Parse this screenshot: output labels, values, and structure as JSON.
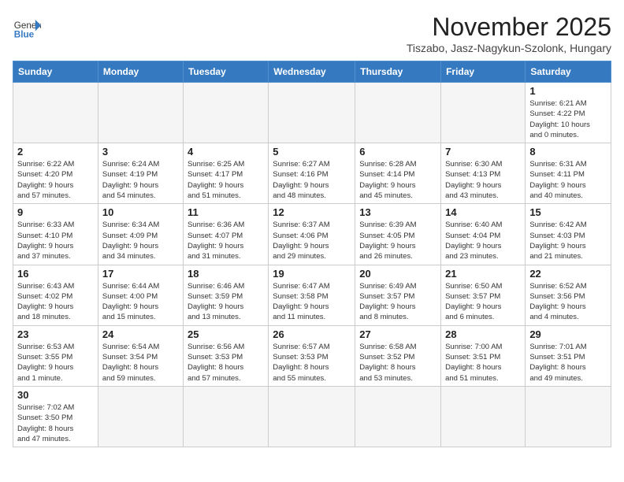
{
  "header": {
    "logo_general": "General",
    "logo_blue": "Blue",
    "month_title": "November 2025",
    "location": "Tiszabo, Jasz-Nagykun-Szolonk, Hungary"
  },
  "weekdays": [
    "Sunday",
    "Monday",
    "Tuesday",
    "Wednesday",
    "Thursday",
    "Friday",
    "Saturday"
  ],
  "weeks": [
    [
      {
        "day": "",
        "info": ""
      },
      {
        "day": "",
        "info": ""
      },
      {
        "day": "",
        "info": ""
      },
      {
        "day": "",
        "info": ""
      },
      {
        "day": "",
        "info": ""
      },
      {
        "day": "",
        "info": ""
      },
      {
        "day": "1",
        "info": "Sunrise: 6:21 AM\nSunset: 4:22 PM\nDaylight: 10 hours\nand 0 minutes."
      }
    ],
    [
      {
        "day": "2",
        "info": "Sunrise: 6:22 AM\nSunset: 4:20 PM\nDaylight: 9 hours\nand 57 minutes."
      },
      {
        "day": "3",
        "info": "Sunrise: 6:24 AM\nSunset: 4:19 PM\nDaylight: 9 hours\nand 54 minutes."
      },
      {
        "day": "4",
        "info": "Sunrise: 6:25 AM\nSunset: 4:17 PM\nDaylight: 9 hours\nand 51 minutes."
      },
      {
        "day": "5",
        "info": "Sunrise: 6:27 AM\nSunset: 4:16 PM\nDaylight: 9 hours\nand 48 minutes."
      },
      {
        "day": "6",
        "info": "Sunrise: 6:28 AM\nSunset: 4:14 PM\nDaylight: 9 hours\nand 45 minutes."
      },
      {
        "day": "7",
        "info": "Sunrise: 6:30 AM\nSunset: 4:13 PM\nDaylight: 9 hours\nand 43 minutes."
      },
      {
        "day": "8",
        "info": "Sunrise: 6:31 AM\nSunset: 4:11 PM\nDaylight: 9 hours\nand 40 minutes."
      }
    ],
    [
      {
        "day": "9",
        "info": "Sunrise: 6:33 AM\nSunset: 4:10 PM\nDaylight: 9 hours\nand 37 minutes."
      },
      {
        "day": "10",
        "info": "Sunrise: 6:34 AM\nSunset: 4:09 PM\nDaylight: 9 hours\nand 34 minutes."
      },
      {
        "day": "11",
        "info": "Sunrise: 6:36 AM\nSunset: 4:07 PM\nDaylight: 9 hours\nand 31 minutes."
      },
      {
        "day": "12",
        "info": "Sunrise: 6:37 AM\nSunset: 4:06 PM\nDaylight: 9 hours\nand 29 minutes."
      },
      {
        "day": "13",
        "info": "Sunrise: 6:39 AM\nSunset: 4:05 PM\nDaylight: 9 hours\nand 26 minutes."
      },
      {
        "day": "14",
        "info": "Sunrise: 6:40 AM\nSunset: 4:04 PM\nDaylight: 9 hours\nand 23 minutes."
      },
      {
        "day": "15",
        "info": "Sunrise: 6:42 AM\nSunset: 4:03 PM\nDaylight: 9 hours\nand 21 minutes."
      }
    ],
    [
      {
        "day": "16",
        "info": "Sunrise: 6:43 AM\nSunset: 4:02 PM\nDaylight: 9 hours\nand 18 minutes."
      },
      {
        "day": "17",
        "info": "Sunrise: 6:44 AM\nSunset: 4:00 PM\nDaylight: 9 hours\nand 15 minutes."
      },
      {
        "day": "18",
        "info": "Sunrise: 6:46 AM\nSunset: 3:59 PM\nDaylight: 9 hours\nand 13 minutes."
      },
      {
        "day": "19",
        "info": "Sunrise: 6:47 AM\nSunset: 3:58 PM\nDaylight: 9 hours\nand 11 minutes."
      },
      {
        "day": "20",
        "info": "Sunrise: 6:49 AM\nSunset: 3:57 PM\nDaylight: 9 hours\nand 8 minutes."
      },
      {
        "day": "21",
        "info": "Sunrise: 6:50 AM\nSunset: 3:57 PM\nDaylight: 9 hours\nand 6 minutes."
      },
      {
        "day": "22",
        "info": "Sunrise: 6:52 AM\nSunset: 3:56 PM\nDaylight: 9 hours\nand 4 minutes."
      }
    ],
    [
      {
        "day": "23",
        "info": "Sunrise: 6:53 AM\nSunset: 3:55 PM\nDaylight: 9 hours\nand 1 minute."
      },
      {
        "day": "24",
        "info": "Sunrise: 6:54 AM\nSunset: 3:54 PM\nDaylight: 8 hours\nand 59 minutes."
      },
      {
        "day": "25",
        "info": "Sunrise: 6:56 AM\nSunset: 3:53 PM\nDaylight: 8 hours\nand 57 minutes."
      },
      {
        "day": "26",
        "info": "Sunrise: 6:57 AM\nSunset: 3:53 PM\nDaylight: 8 hours\nand 55 minutes."
      },
      {
        "day": "27",
        "info": "Sunrise: 6:58 AM\nSunset: 3:52 PM\nDaylight: 8 hours\nand 53 minutes."
      },
      {
        "day": "28",
        "info": "Sunrise: 7:00 AM\nSunset: 3:51 PM\nDaylight: 8 hours\nand 51 minutes."
      },
      {
        "day": "29",
        "info": "Sunrise: 7:01 AM\nSunset: 3:51 PM\nDaylight: 8 hours\nand 49 minutes."
      }
    ],
    [
      {
        "day": "30",
        "info": "Sunrise: 7:02 AM\nSunset: 3:50 PM\nDaylight: 8 hours\nand 47 minutes."
      },
      {
        "day": "",
        "info": ""
      },
      {
        "day": "",
        "info": ""
      },
      {
        "day": "",
        "info": ""
      },
      {
        "day": "",
        "info": ""
      },
      {
        "day": "",
        "info": ""
      },
      {
        "day": "",
        "info": ""
      }
    ]
  ]
}
